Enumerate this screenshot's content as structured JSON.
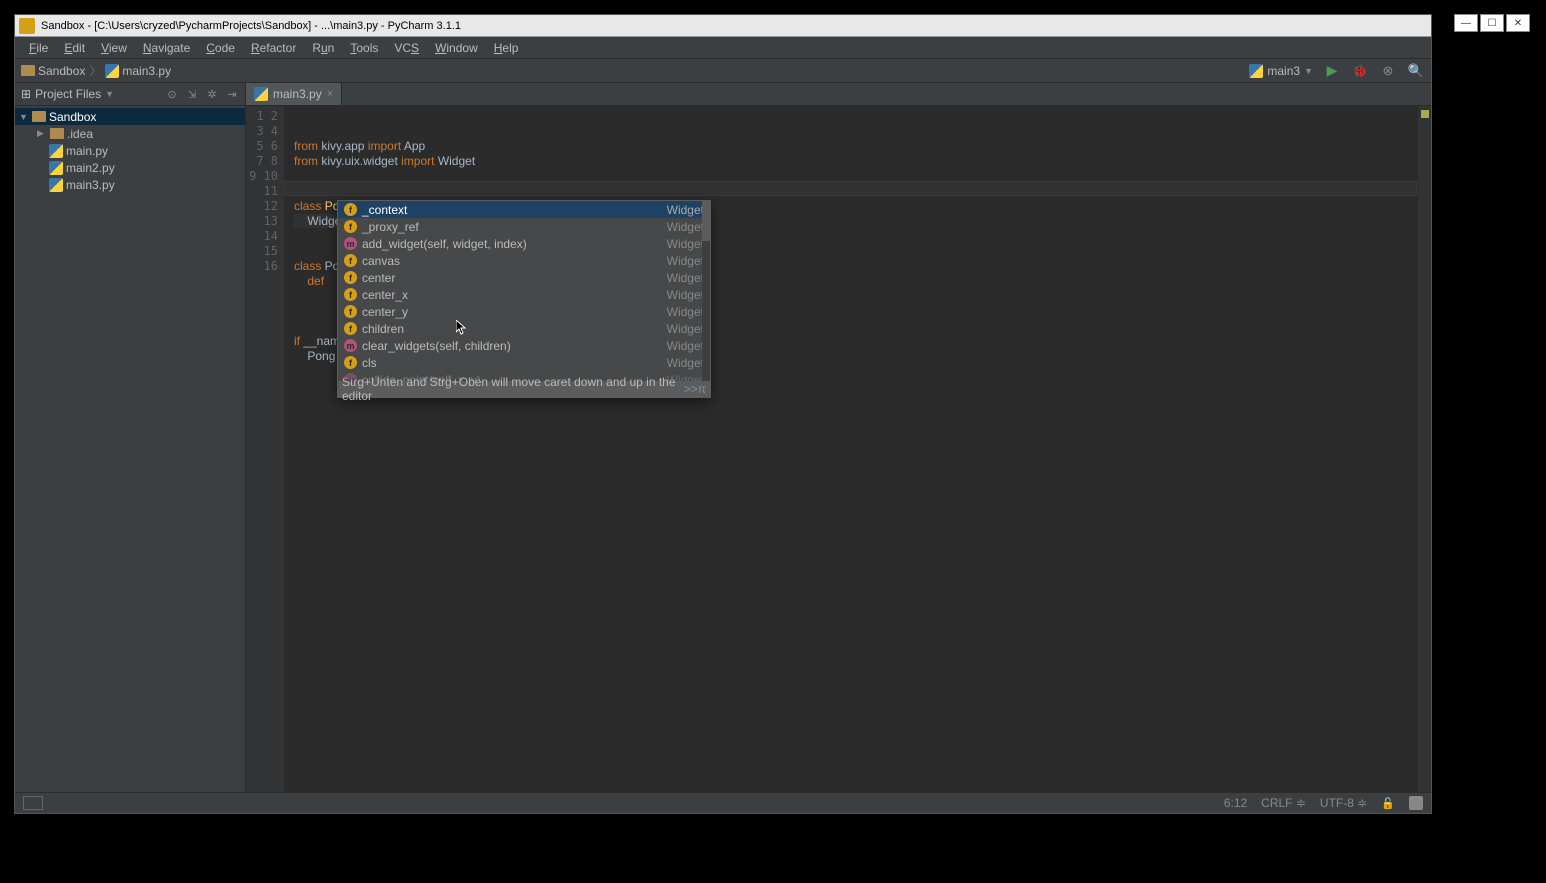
{
  "title": "Sandbox - [C:\\Users\\cryzed\\PycharmProjects\\Sandbox] - ...\\main3.py - PyCharm 3.1.1",
  "menu": [
    "File",
    "Edit",
    "View",
    "Navigate",
    "Code",
    "Refactor",
    "Run",
    "Tools",
    "VCS",
    "Window",
    "Help"
  ],
  "breadcrumb": {
    "root": "Sandbox",
    "file": "main3.py"
  },
  "run_config": "main3",
  "sidebar": {
    "title": "Project Files",
    "tree": {
      "root": "Sandbox",
      "idea": ".idea",
      "files": [
        "main.py",
        "main2.py",
        "main3.py"
      ]
    }
  },
  "tab": {
    "name": "main3.py"
  },
  "code": {
    "lines": [
      "from kivy.app import App",
      "from kivy.uix.widget import Widget",
      "",
      "",
      "class PongGame(Widget):",
      "    Widget.",
      "",
      "",
      "class Po",
      "    def ",
      "        ",
      "",
      "",
      "if __nam",
      "    Pong",
      ""
    ]
  },
  "completion": {
    "items": [
      {
        "icon": "f",
        "name": "_context",
        "type": "Widget"
      },
      {
        "icon": "f",
        "name": "_proxy_ref",
        "type": "Widget"
      },
      {
        "icon": "m",
        "name": "add_widget(self, widget, index)",
        "type": "Widget"
      },
      {
        "icon": "f",
        "name": "canvas",
        "type": "Widget"
      },
      {
        "icon": "f",
        "name": "center",
        "type": "Widget"
      },
      {
        "icon": "f",
        "name": "center_x",
        "type": "Widget"
      },
      {
        "icon": "f",
        "name": "center_y",
        "type": "Widget"
      },
      {
        "icon": "f",
        "name": "children",
        "type": "Widget"
      },
      {
        "icon": "m",
        "name": "clear_widgets(self, children)",
        "type": "Widget"
      },
      {
        "icon": "f",
        "name": "cls",
        "type": "Widget"
      },
      {
        "icon": "m",
        "name": "collide_point(self, x, y)",
        "type": "Widget"
      }
    ],
    "hint": "Strg+Unten and Strg+Oben will move caret down and up in the editor",
    "hint_link": ">>"
  },
  "status": {
    "pos": "6:12",
    "lineend": "CRLF",
    "encoding": "UTF-8"
  }
}
